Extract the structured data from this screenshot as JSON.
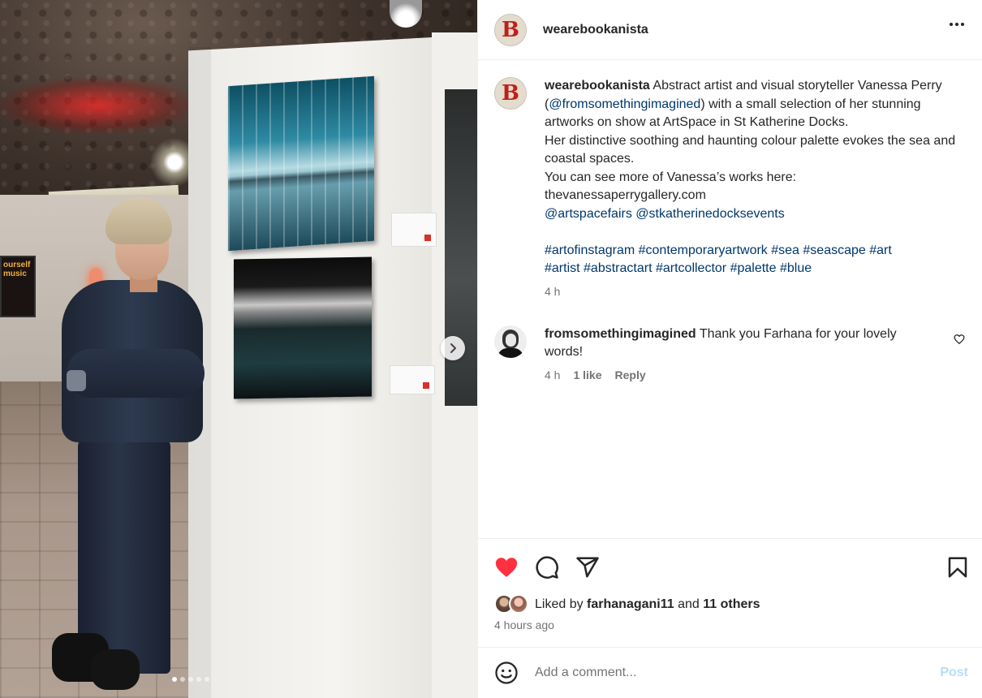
{
  "post": {
    "username": "wearebookanista",
    "avatar_letter": "B",
    "caption": {
      "username": "wearebookanista",
      "line_1": "Abstract artist and visual storyteller Vanessa Perry (",
      "mention_1": "@fromsomethingimagined",
      "line_1b": ") with a small selection of her stunning artworks on show at ArtSpace in St Katherine Docks.",
      "line_2": "Her distinctive soothing and haunting colour palette evokes the sea and coastal spaces.",
      "line_3": "You can see more of Vanessa’s works here:",
      "line_4": "thevanessaperrygallery.com",
      "mention_2": "@artspacefairs",
      "mention_3": "@stkatherinedocksevents",
      "hashtags": [
        "#artofinstagram",
        "#contemporaryartwork",
        "#sea",
        "#seascape",
        "#art",
        "#artist",
        "#abstractart",
        "#artcollector",
        "#palette",
        "#blue"
      ],
      "time": "4 h"
    },
    "comments": [
      {
        "username": "fromsomethingimagined",
        "text": "Thank you Farhana for your lovely words!",
        "time": "4 h",
        "likes": "1 like",
        "reply_label": "Reply"
      }
    ],
    "likes": {
      "prefix": "Liked by",
      "user": "farhanagani11",
      "and": "and",
      "others": "11 others"
    },
    "timestamp": "4 hours ago",
    "comment_input": {
      "placeholder": "Add a comment..."
    },
    "post_button": "Post",
    "photo": {
      "poster_text": "ourself music",
      "carousel_dots": 5,
      "active_dot": 0
    },
    "icons": {
      "more": "more-options-icon",
      "like": "heart-filled-icon",
      "comment": "comment-bubble-icon",
      "share": "paper-plane-icon",
      "save": "bookmark-icon",
      "emoji": "smiley-icon",
      "next": "chevron-right-icon"
    },
    "colors": {
      "like_red": "#ff3040",
      "link_blue": "#00376b",
      "post_button_disabled": "#b2dffc",
      "secondary_text": "#737373"
    }
  }
}
